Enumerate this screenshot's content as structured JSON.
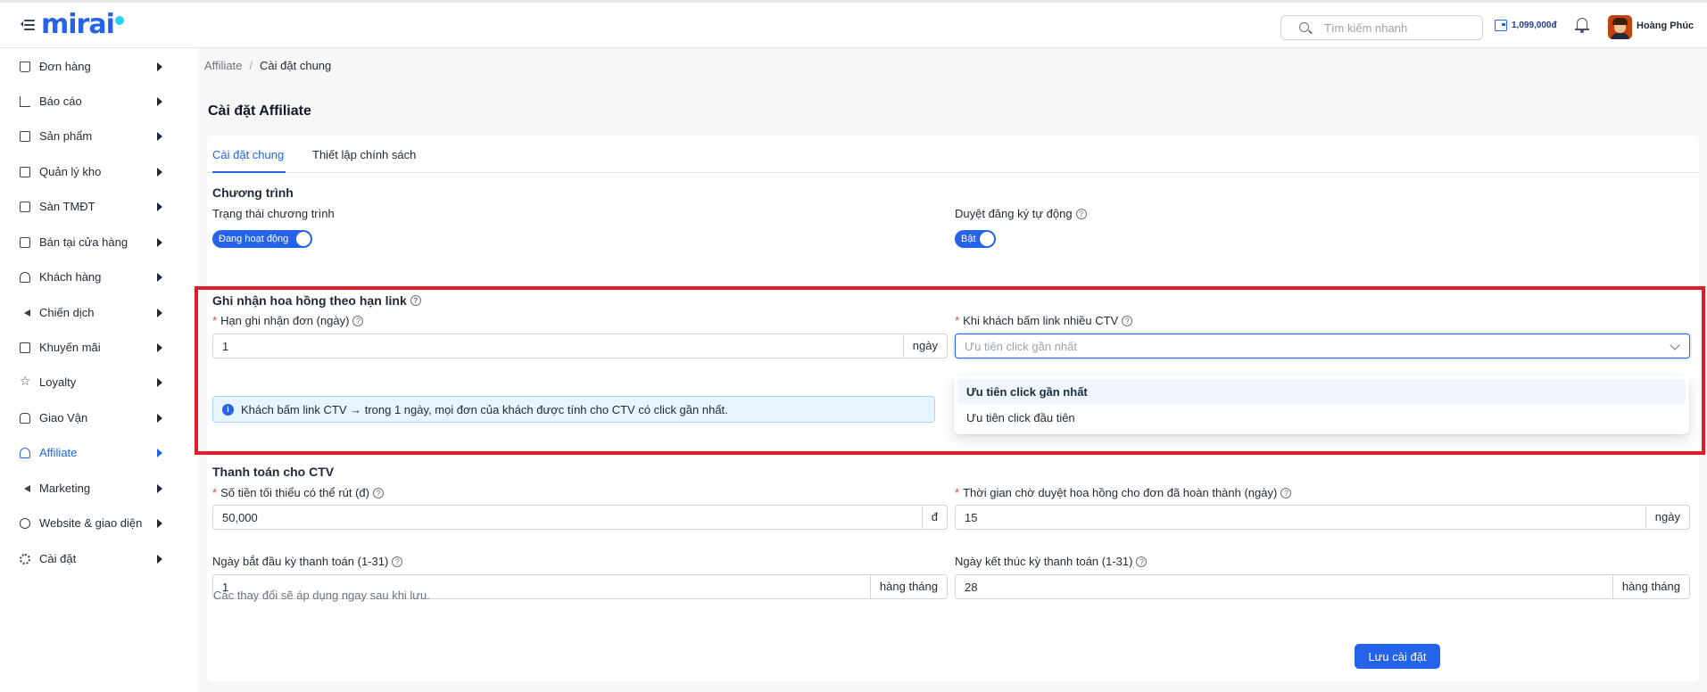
{
  "header": {
    "logo_text": "mirai",
    "search_placeholder": "Tìm kiếm nhanh",
    "balance": "1,099,000đ",
    "user_name": "Hoàng Phúc"
  },
  "sidebar": {
    "items": [
      {
        "label": "Đơn hàng",
        "icon": "bag-icon"
      },
      {
        "label": "Báo cáo",
        "icon": "bar-chart-icon"
      },
      {
        "label": "Sản phẩm",
        "icon": "box-icon"
      },
      {
        "label": "Quản lý kho",
        "icon": "warehouse-icon"
      },
      {
        "label": "Sàn TMĐT",
        "icon": "marketplace-icon"
      },
      {
        "label": "Bán tại cửa hàng",
        "icon": "store-icon"
      },
      {
        "label": "Khách hàng",
        "icon": "users-icon"
      },
      {
        "label": "Chiến dịch",
        "icon": "megaphone-icon"
      },
      {
        "label": "Khuyến mãi",
        "icon": "gift-icon"
      },
      {
        "label": "Loyalty",
        "icon": "star-icon"
      },
      {
        "label": "Giao Vận",
        "icon": "car-icon"
      },
      {
        "label": "Affiliate",
        "icon": "affiliate-icon",
        "active": true
      },
      {
        "label": "Marketing",
        "icon": "megaphone-icon"
      },
      {
        "label": "Website & giao diện",
        "icon": "globe-icon"
      },
      {
        "label": "Cài đặt",
        "icon": "gear-icon"
      }
    ]
  },
  "breadcrumb": {
    "parent": "Affiliate",
    "separator": "/",
    "current": "Cài đặt chung"
  },
  "page": {
    "title": "Cài đặt Affiliate"
  },
  "tabs": [
    {
      "label": "Cài đặt chung",
      "active": true
    },
    {
      "label": "Thiết lập chính sách",
      "active": false
    }
  ],
  "program": {
    "section_title": "Chương trình",
    "status_label": "Trạng thái chương trình",
    "status_toggle": "Đang hoạt động",
    "auto_approve_label": "Duyệt đăng ký tự động",
    "auto_approve_toggle": "Bật"
  },
  "commission": {
    "section_title": "Ghi nhận hoa hồng theo hạn link",
    "window_label": "Hạn ghi nhận đơn (ngày)",
    "window_value": "1",
    "window_unit": "ngày",
    "multi_ctv_label": "Khi khách bấm link nhiều CTV",
    "multi_ctv_placeholder": "Ưu tiên click gần nhất",
    "options": [
      "Ưu tiên click gần nhất",
      "Ưu tiên click đầu tiên"
    ],
    "info_text": "Khách bấm link CTV → trong 1 ngày, mọi đơn của khách được tính cho CTV có click gần nhất."
  },
  "payout": {
    "section_title": "Thanh toán cho CTV",
    "min_withdraw_label": "Số tiền tối thiểu có thể rút (đ)",
    "min_withdraw_value": "50,000",
    "min_withdraw_unit": "đ",
    "wait_label": "Thời gian chờ duyệt hoa hồng cho đơn đã hoàn thành (ngày)",
    "wait_value": "15",
    "wait_unit": "ngày",
    "start_day_label": "Ngày bắt đầu kỳ thanh toán (1-31)",
    "start_day_value": "1",
    "start_day_unit": "hàng tháng",
    "end_day_label": "Ngày kết thúc kỳ thanh toán (1-31)",
    "end_day_value": "28",
    "end_day_unit": "hàng tháng"
  },
  "footer": {
    "note": "Các thay đổi sẽ áp dụng ngay sau khi lưu.",
    "save_label": "Lưu cài đặt"
  },
  "colors": {
    "accent": "#2563eb",
    "highlight": "#e11d2c",
    "info_bg": "#e8f4ff"
  }
}
